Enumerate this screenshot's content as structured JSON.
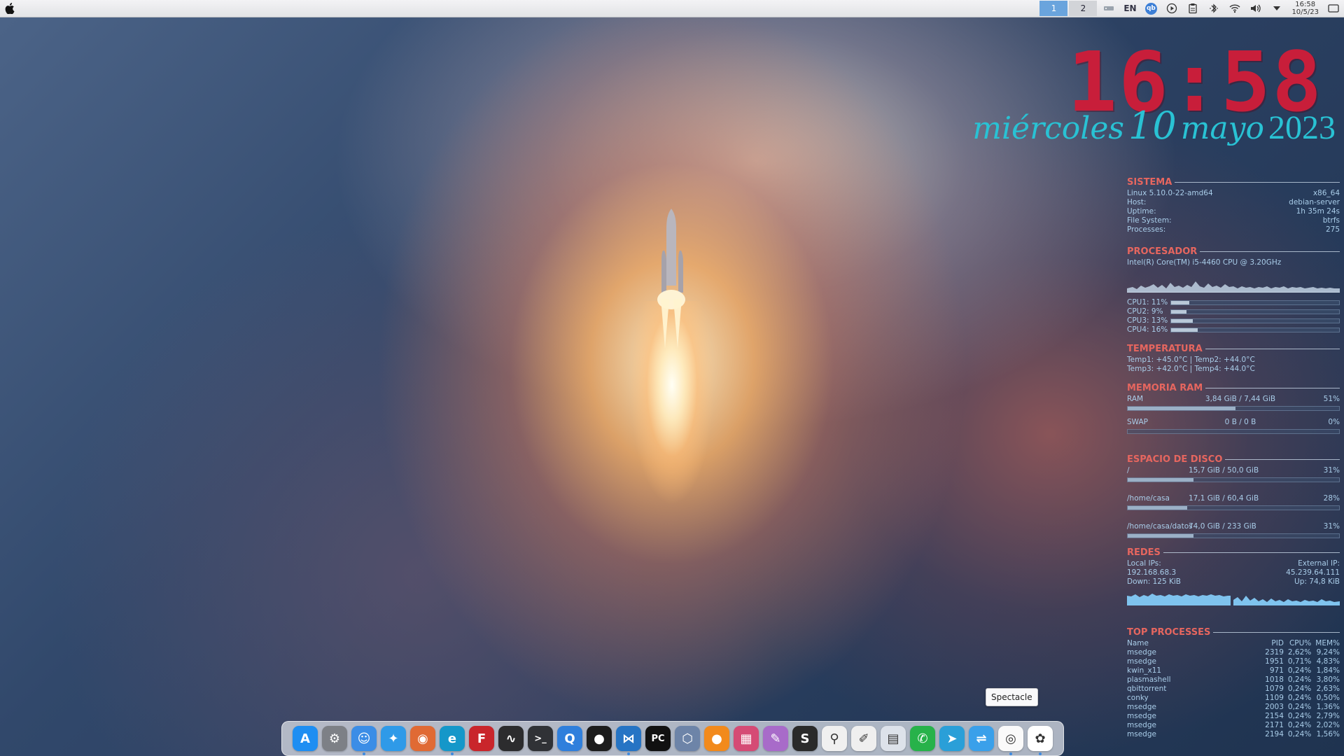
{
  "menubar": {
    "desktops": [
      "1",
      "2"
    ],
    "language": "EN",
    "qb_label": "qb",
    "time": "16:58",
    "date": "10/5/23"
  },
  "clock": {
    "time": "16:58",
    "weekday": "miércoles",
    "day": "10",
    "month": "mayo",
    "year": "2023"
  },
  "conky": {
    "sistema": {
      "header": "SISTEMA",
      "rows": [
        {
          "label": "Linux 5.10.0-22-amd64",
          "value": "x86_64"
        },
        {
          "label": "Host:",
          "value": "debian-server"
        },
        {
          "label": "Uptime:",
          "value": "1h 35m 24s"
        },
        {
          "label": "File System:",
          "value": "btrfs"
        },
        {
          "label": "Processes:",
          "value": "275"
        }
      ]
    },
    "procesador": {
      "header": "PROCESADOR",
      "model": "Intel(R) Core(TM) i5-4460  CPU @ 3.20GHz",
      "cpus": [
        {
          "label": "CPU1: 11%",
          "value": 11
        },
        {
          "label": "CPU2: 9%",
          "value": 9
        },
        {
          "label": "CPU3: 13%",
          "value": 13
        },
        {
          "label": "CPU4: 16%",
          "value": 16
        }
      ]
    },
    "temperatura": {
      "header": "TEMPERATURA",
      "line1": "Temp1: +45.0°C  | Temp2: +44.0°C",
      "line2": "Temp3: +42.0°C  | Temp4: +44.0°C"
    },
    "memoria": {
      "header": "MEMORIA RAM",
      "rows": [
        {
          "label": "RAM",
          "usage": "3,84 GiB / 7,44 GiB",
          "pct": "51%",
          "value": 51
        },
        {
          "label": "SWAP",
          "usage": "0 B / 0 B",
          "pct": "0%",
          "value": 0
        }
      ]
    },
    "disco": {
      "header": "ESPACIO DE DISCO",
      "rows": [
        {
          "mount": "/",
          "usage": "15,7 GiB / 50,0 GiB",
          "pct": "31%",
          "value": 31
        },
        {
          "mount": "/home/casa",
          "usage": "17,1 GiB / 60,4 GiB",
          "pct": "28%",
          "value": 28
        },
        {
          "mount": "/home/casa/datos",
          "usage": "74,0 GiB / 233 GiB",
          "pct": "31%",
          "value": 31
        }
      ]
    },
    "redes": {
      "header": "REDES",
      "local_label": "Local IPs:",
      "external_label": "External IP:",
      "local_ip": "192.168.68.3",
      "external_ip": "45.239.64.111",
      "down": "Down: 125 KiB",
      "up": "Up: 74,8 KiB"
    },
    "procesos": {
      "header": "TOP PROCESSES",
      "columns": [
        "Name",
        "PID",
        "CPU%",
        "MEM%"
      ],
      "rows": [
        [
          "msedge",
          "2319",
          "2,62%",
          "9,24%"
        ],
        [
          "msedge",
          "1951",
          "0,71%",
          "4,83%"
        ],
        [
          "kwin_x11",
          "971",
          "0,24%",
          "1,84%"
        ],
        [
          "plasmashell",
          "1018",
          "0,24%",
          "3,80%"
        ],
        [
          "qbittorrent",
          "1079",
          "0,24%",
          "2,63%"
        ],
        [
          "conky",
          "1109",
          "0,24%",
          "0,50%"
        ],
        [
          "msedge",
          "2003",
          "0,24%",
          "1,36%"
        ],
        [
          "msedge",
          "2154",
          "0,24%",
          "2,79%"
        ],
        [
          "msedge",
          "2171",
          "0,24%",
          "2,02%"
        ],
        [
          "msedge",
          "2194",
          "0,24%",
          "1,56%"
        ]
      ]
    }
  },
  "tooltip": "Spectacle",
  "dock": [
    {
      "name": "app-store-icon",
      "glyph": "A",
      "color": "#1e8ef2",
      "active": false
    },
    {
      "name": "system-settings-icon",
      "glyph": "⚙",
      "color": "#7d8086",
      "active": false
    },
    {
      "name": "finder-icon",
      "glyph": "☺",
      "color": "#3b8de6",
      "active": true
    },
    {
      "name": "safari-icon",
      "glyph": "✦",
      "color": "#2f9ae8",
      "active": false
    },
    {
      "name": "firefox-icon",
      "glyph": "◉",
      "color": "#e06a34",
      "active": false
    },
    {
      "name": "edge-icon",
      "glyph": "e",
      "color": "#1597c9",
      "active": true
    },
    {
      "name": "filezilla-icon",
      "glyph": "F",
      "color": "#c9252b",
      "active": false
    },
    {
      "name": "system-monitor-icon",
      "glyph": "∿",
      "color": "#2c2c2e",
      "active": false
    },
    {
      "name": "terminal-icon",
      "glyph": ">_",
      "color": "#303236",
      "active": false
    },
    {
      "name": "quicktime-icon",
      "glyph": "Q",
      "color": "#2f7fdc",
      "active": false
    },
    {
      "name": "github-icon",
      "glyph": "●",
      "color": "#1c1c1c",
      "active": false
    },
    {
      "name": "vscode-icon",
      "glyph": "⋈",
      "color": "#2674c4",
      "active": true
    },
    {
      "name": "pycharm-icon",
      "glyph": "PC",
      "color": "#111111",
      "active": false
    },
    {
      "name": "virtualbox-icon",
      "glyph": "⬡",
      "color": "#6d84a8",
      "active": false
    },
    {
      "name": "orange-app-icon",
      "glyph": "●",
      "color": "#f28a1c",
      "active": false
    },
    {
      "name": "office-icon",
      "glyph": "▦",
      "color": "#d54b75",
      "active": false
    },
    {
      "name": "paint-icon",
      "glyph": "✎",
      "color": "#a86bc9",
      "active": false
    },
    {
      "name": "script-icon",
      "glyph": "S",
      "color": "#2a2a2a",
      "active": false
    },
    {
      "name": "attachment-icon",
      "glyph": "⚲",
      "color": "#f0f0f0",
      "active": false
    },
    {
      "name": "notes-icon",
      "glyph": "✐",
      "color": "#efefef",
      "active": false
    },
    {
      "name": "reader-icon",
      "glyph": "▤",
      "color": "#dde2ea",
      "active": false
    },
    {
      "name": "whatsapp-icon",
      "glyph": "✆",
      "color": "#27b24a",
      "active": false
    },
    {
      "name": "telegram-icon",
      "glyph": "➤",
      "color": "#2a9fd8",
      "active": false
    },
    {
      "name": "remote-desktop-icon",
      "glyph": "⇌",
      "color": "#3aa0ea",
      "active": false
    },
    {
      "name": "spectacle-icon",
      "glyph": "◎",
      "color": "#fafafa",
      "active": true
    },
    {
      "name": "photos-icon",
      "glyph": "✿",
      "color": "#ffffff",
      "active": true
    }
  ],
  "colors": {
    "clock": "#c81e3a",
    "date": "#29c2d4",
    "section_header": "#e6665f",
    "conky_text": "#a9cde9",
    "graph": "#7fc3ee"
  }
}
